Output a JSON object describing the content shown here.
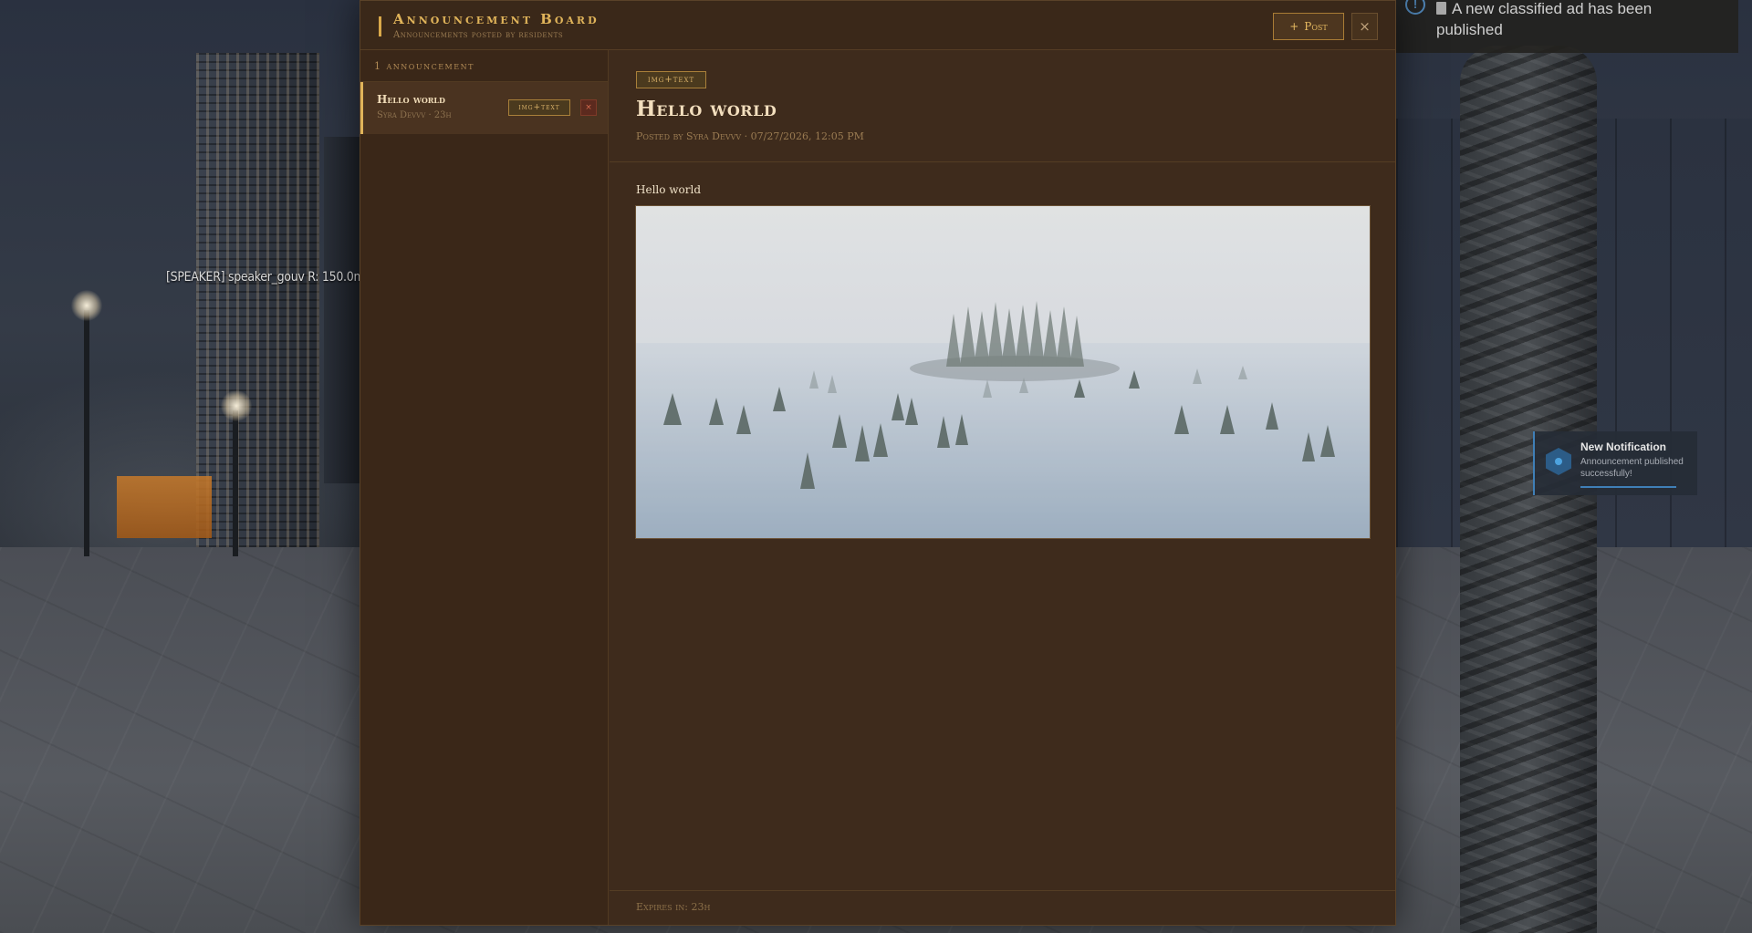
{
  "hud": {
    "speaker_label": "[SPEAKER] speaker_gouv   R: 150.0m"
  },
  "toast_top": {
    "icon": "info-icon",
    "message_line1": "A new classified ad has been",
    "message_line2": "published"
  },
  "notification": {
    "icon": "hexagon-bell-icon",
    "title": "New Notification",
    "message": "Announcement published successfully!"
  },
  "board": {
    "title": "Announcement Board",
    "subtitle": "Announcements posted by residents",
    "post_button_label": "Post",
    "post_button_icon": "+",
    "close_icon": "×",
    "accent_color": "#e0b45a"
  },
  "sidebar": {
    "count_label": "1 announcement",
    "items": [
      {
        "title": "Hello world",
        "meta": "Syra Devvv · 23h",
        "tag": "img+text",
        "delete_icon": "×"
      }
    ]
  },
  "detail": {
    "tag": "img+text",
    "title": "Hello world",
    "meta": "Posted by Syra Devvv · 07/27/2026, 12:05 PM",
    "body": "Hello world",
    "image": "foggy-lake-with-pine-tree-islands",
    "expires": "Expires in: 23h"
  }
}
